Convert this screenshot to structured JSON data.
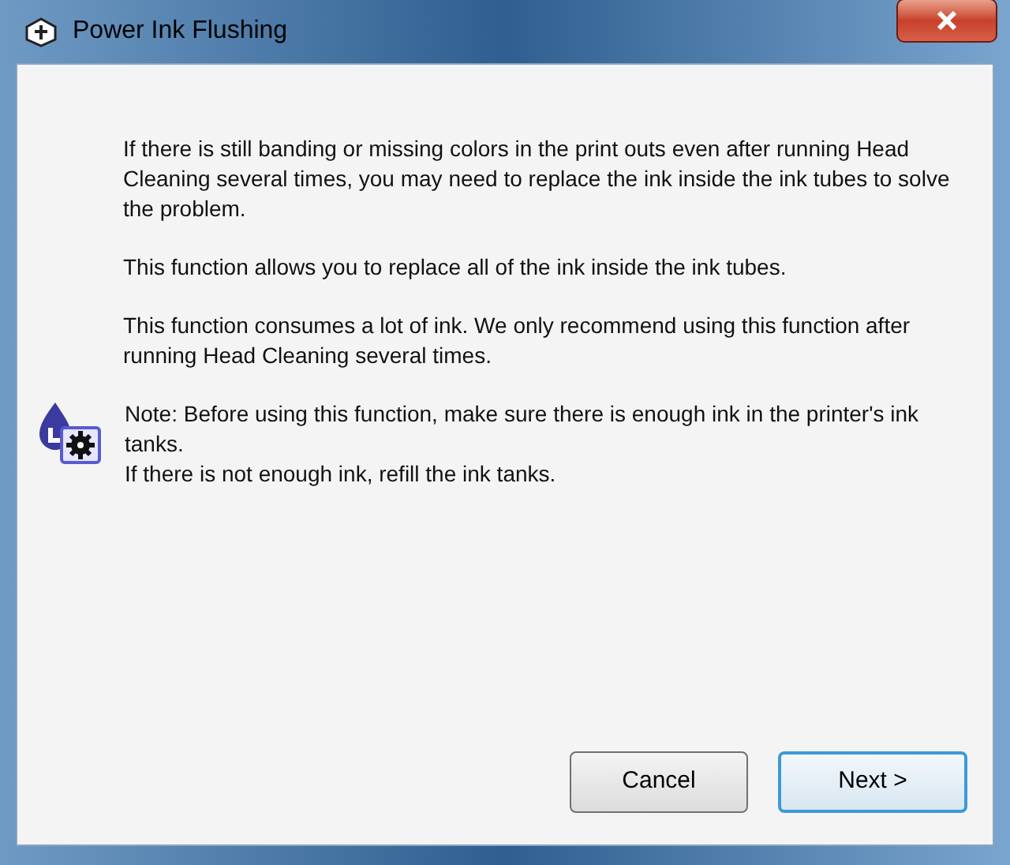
{
  "window": {
    "title": "Power Ink Flushing"
  },
  "paragraphs": [
    "If there is still banding or missing colors in the print outs even after running Head Cleaning several times, you may need to replace the ink inside the ink tubes to solve the problem.",
    "This function allows you to replace all of the ink inside the ink tubes.",
    "This function consumes a lot of ink. We only recommend using this function after running Head Cleaning several times."
  ],
  "note": {
    "lines": [
      "Note: Before using this function, make sure there is enough ink in the printer's ink tanks.",
      "If there is not enough ink, refill the ink tanks."
    ]
  },
  "buttons": [
    {
      "label": "Cancel",
      "default": false
    },
    {
      "label": "Next >",
      "default": true
    }
  ]
}
